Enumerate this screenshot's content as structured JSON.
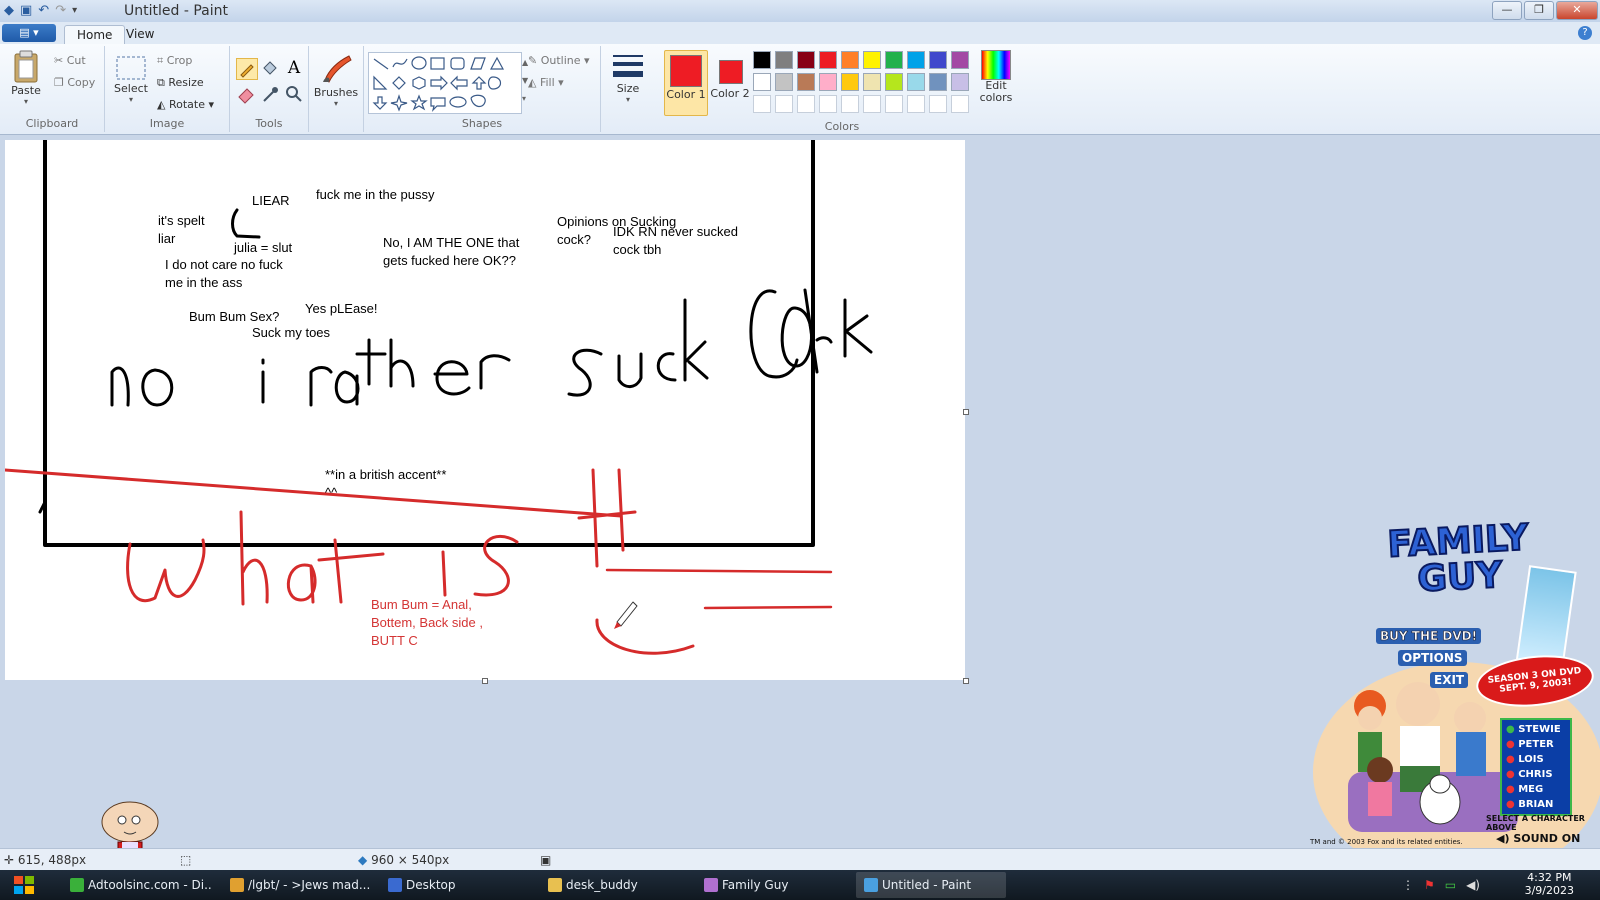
{
  "window": {
    "title": "Untitled - Paint"
  },
  "tabs": {
    "home": "Home",
    "view": "View"
  },
  "ribbon": {
    "clipboard": {
      "label": "Clipboard",
      "paste": "Paste",
      "cut": "Cut",
      "copy": "Copy"
    },
    "image": {
      "label": "Image",
      "select": "Select",
      "crop": "Crop",
      "resize": "Resize",
      "rotate": "Rotate"
    },
    "tools": {
      "label": "Tools"
    },
    "brushes": {
      "label": "Brushes"
    },
    "shapes": {
      "label": "Shapes",
      "outline": "Outline",
      "fill": "Fill"
    },
    "size": {
      "label": "Size"
    },
    "colors": {
      "label": "Colors",
      "color1": "Color 1",
      "color2": "Color 2",
      "color1_value": "#ee1c24",
      "color2_value": "#ee1c24",
      "edit": "Edit colors",
      "palette_row1": [
        "#000000",
        "#7f7f7f",
        "#880015",
        "#ed1c24",
        "#ff7f27",
        "#fff200",
        "#22b14c",
        "#00a2e8",
        "#3f48cc",
        "#a349a4"
      ],
      "palette_row2": [
        "#ffffff",
        "#c3c3c3",
        "#b97a57",
        "#ffaec9",
        "#ffc90e",
        "#efe4b0",
        "#b5e61d",
        "#99d9ea",
        "#7092be",
        "#c8bfe7"
      ]
    }
  },
  "canvas": {
    "texts": {
      "liear": "LIEAR",
      "fuck_pussy": "fuck me in the pussy",
      "its_spelt": "it's spelt\nliar",
      "julia": "julia = slut",
      "no_care": "I do not care no fuck\nme in the ass",
      "i_am_the_one": "No, I AM THE ONE that\ngets fucked here OK??",
      "opinions": "Opinions on Sucking\ncock?",
      "idk": "IDK RN never sucked\ncock tbh",
      "yes_please": "Yes pLEase!",
      "bum_bum_sex": "Bum Bum Sex?",
      "suck_toes": "Suck my toes",
      "british": "**in a british accent**\n^^",
      "bum_def": "Bum Bum = Anal,\nBottem, Back side ,\nBUTT C"
    }
  },
  "status": {
    "cursor": "615, 488px",
    "canvas_size": "960 × 540px"
  },
  "overlay": {
    "fg_title": "FAMILY GUY",
    "fg_dvd": "BUY THE DVD!",
    "fg_options": "OPTIONS",
    "fg_exit": "EXIT",
    "fg_season": "SEASON 3 ON DVD SEPT. 9, 2003!",
    "fg_characters": [
      "STEWIE",
      "PETER",
      "LOIS",
      "CHRIS",
      "MEG",
      "BRIAN"
    ],
    "fg_select": "SELECT A CHARACTER ABOVE",
    "fg_copyright": "TM and © 2003 Fox and its related entities.",
    "fg_sound": "SOUND ON"
  },
  "taskbar": {
    "items": [
      "Adtoolsinc.com - Di...",
      "/lgbt/ - >Jews mad...",
      "Desktop",
      "desk_buddy",
      "Family Guy",
      "Untitled - Paint"
    ],
    "time": "4:32 PM",
    "date": "3/9/2023"
  }
}
